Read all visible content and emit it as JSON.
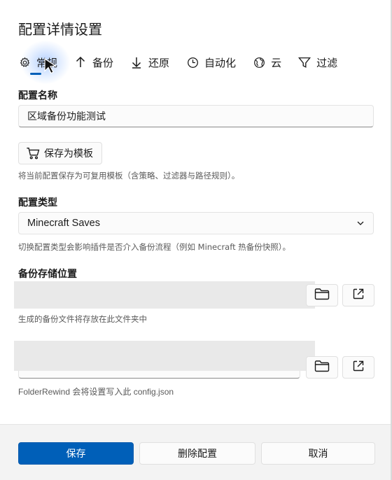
{
  "dialog": {
    "title": "配置详情设置"
  },
  "tabs": [
    {
      "label": "常规",
      "icon": "gear-icon",
      "active": true
    },
    {
      "label": "备份",
      "icon": "arrow-up-icon",
      "active": false
    },
    {
      "label": "还原",
      "icon": "arrow-down-icon",
      "active": false
    },
    {
      "label": "自动化",
      "icon": "clock-icon",
      "active": false
    },
    {
      "label": "云",
      "icon": "cloud-globe-icon",
      "active": false
    },
    {
      "label": "过滤",
      "icon": "filter-icon",
      "active": false
    }
  ],
  "config_name": {
    "label": "配置名称",
    "value": "区域备份功能测试"
  },
  "template": {
    "button_label": "保存为模板",
    "hint": "将当前配置保存为可复用模板（含策略、过滤器与路径规则）。"
  },
  "config_type": {
    "label": "配置类型",
    "selected": "Minecraft Saves",
    "hint": "切换配置类型会影响插件是否介入备份流程（例如 Minecraft 热备份快照）。"
  },
  "backup_location": {
    "label": "备份存储位置",
    "value": "",
    "hint": "生成的备份文件将存放在此文件夹中"
  },
  "config_location": {
    "label": "",
    "value": "",
    "hint": "FolderRewind 会将设置写入此 config.json"
  },
  "footer": {
    "save_label": "保存",
    "delete_label": "删除配置",
    "cancel_label": "取消"
  },
  "colors": {
    "accent": "#005fb8",
    "footer_bg": "#f3f3f3"
  }
}
